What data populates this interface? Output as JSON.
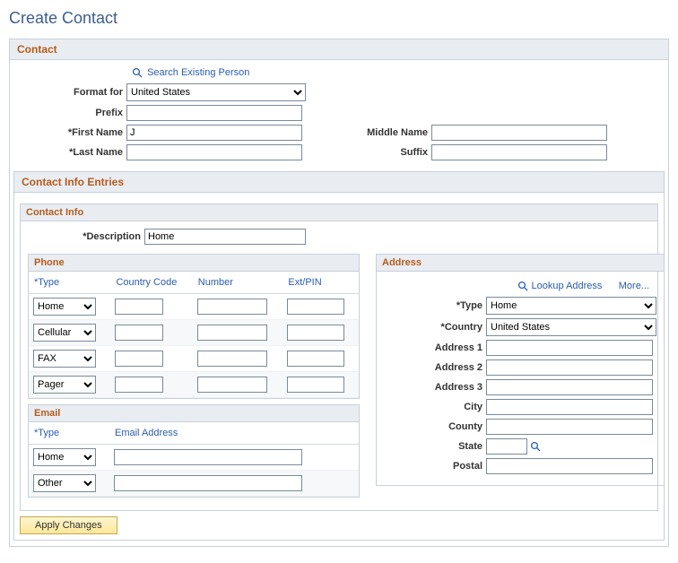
{
  "pageTitle": "Create Contact",
  "contactSection": {
    "title": "Contact",
    "searchLink": "Search Existing Person",
    "fields": {
      "formatFor": {
        "label": "Format for",
        "value": "United States"
      },
      "prefix": {
        "label": "Prefix",
        "value": ""
      },
      "firstName": {
        "label": "First Name",
        "value": "J",
        "req": true
      },
      "lastName": {
        "label": "Last Name",
        "value": "",
        "req": true
      },
      "middleName": {
        "label": "Middle Name",
        "value": ""
      },
      "suffix": {
        "label": "Suffix",
        "value": ""
      }
    }
  },
  "contactInfoEntries": {
    "title": "Contact Info Entries",
    "contactInfo": {
      "title": "Contact Info",
      "description": {
        "label": "Description",
        "value": "Home",
        "req": true
      }
    },
    "phone": {
      "title": "Phone",
      "columns": {
        "type": "Type",
        "countryCode": "Country Code",
        "number": "Number",
        "extPin": "Ext/PIN"
      },
      "rows": [
        {
          "type": "Home",
          "countryCode": "",
          "number": "",
          "extPin": ""
        },
        {
          "type": "Cellular",
          "countryCode": "",
          "number": "",
          "extPin": ""
        },
        {
          "type": "FAX",
          "countryCode": "",
          "number": "",
          "extPin": ""
        },
        {
          "type": "Pager",
          "countryCode": "",
          "number": "",
          "extPin": ""
        }
      ]
    },
    "email": {
      "title": "Email",
      "columns": {
        "type": "Type",
        "emailAddress": "Email Address"
      },
      "rows": [
        {
          "type": "Home",
          "email": ""
        },
        {
          "type": "Other",
          "email": ""
        }
      ]
    },
    "address": {
      "title": "Address",
      "lookupLink": "Lookup Address",
      "moreLink": "More...",
      "fields": {
        "type": {
          "label": "Type",
          "value": "Home",
          "req": true
        },
        "country": {
          "label": "Country",
          "value": "United States",
          "req": true
        },
        "address1": {
          "label": "Address 1",
          "value": ""
        },
        "address2": {
          "label": "Address 2",
          "value": ""
        },
        "address3": {
          "label": "Address 3",
          "value": ""
        },
        "city": {
          "label": "City",
          "value": ""
        },
        "county": {
          "label": "County",
          "value": ""
        },
        "state": {
          "label": "State",
          "value": ""
        },
        "postal": {
          "label": "Postal",
          "value": ""
        }
      }
    }
  },
  "applyButton": "Apply Changes"
}
